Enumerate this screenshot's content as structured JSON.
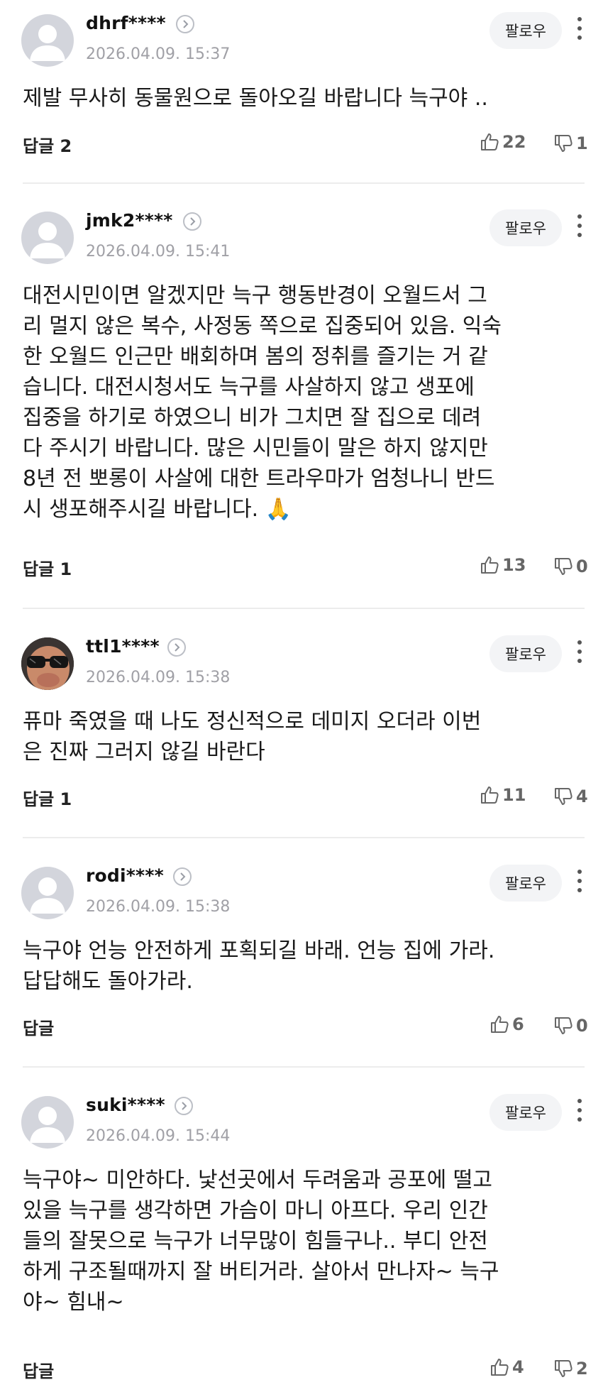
{
  "colors": {
    "text": "#1a1a1a",
    "muted": "#a0a0a6",
    "follow_bg": "#f3f4f6",
    "divider": "#ececec"
  },
  "icons": {
    "profile_chevron": "chevron-right-icon",
    "more": "more-vertical-icon",
    "like": "thumbs-up-icon",
    "dislike": "thumbs-down-icon"
  },
  "comments": [
    {
      "username": "dhrf****",
      "date": "2026.04.09. 15:37",
      "follow_label": "팔로우",
      "text": "제발 무사히 동물원으로 돌아오길 바랍니다 늑구야 ..",
      "reply_label": "답글 2",
      "likes": "22",
      "dislikes": "1"
    },
    {
      "username": "jmk2****",
      "date": "2026.04.09. 15:41",
      "follow_label": "팔로우",
      "text": "대전시민이면 알겠지만 늑구 행동반경이 오월드서 그\n리 멀지 않은 복수, 사정동 쪽으로 집중되어 있음. 익숙\n한 오월드 인근만 배회하며 봄의 정취를 즐기는 거 같\n습니다. 대전시청서도 늑구를 사살하지 않고 생포에\n집중을 하기로 하였으니 비가 그치면 잘 집으로 데려\n다 주시기 바랍니다. 많은 시민들이 말은 하지 않지만\n8년 전 뽀롱이 사살에 대한 트라우마가 엄청나니 반드\n시 생포해주시길 바랍니다. 🙏",
      "reply_label": "답글 1",
      "likes": "13",
      "dislikes": "0"
    },
    {
      "username": "ttl1****",
      "date": "2026.04.09. 15:38",
      "follow_label": "팔로우",
      "text": "퓨마 죽였을 때 나도 정신적으로 데미지 오더라 이번\n은 진짜 그러지 않길 바란다",
      "reply_label": "답글 1",
      "likes": "11",
      "dislikes": "4"
    },
    {
      "username": "rodi****",
      "date": "2026.04.09. 15:38",
      "follow_label": "팔로우",
      "text": "늑구야 언능 안전하게 포획되길 바래. 언능 집에 가라.\n답답해도 돌아가라.",
      "reply_label": "답글",
      "likes": "6",
      "dislikes": "0"
    },
    {
      "username": "suki****",
      "date": "2026.04.09. 15:44",
      "follow_label": "팔로우",
      "text": "늑구야~ 미안하다. 낯선곳에서 두려움과 공포에 떨고\n있을 늑구를 생각하면 가슴이 마니 아프다. 우리 인간\n들의 잘못으로 늑구가 너무많이 힘들구나.. 부디 안전\n하게 구조될때까지 잘 버티거라. 살아서 만나자~ 늑구\n야~ 힘내~",
      "reply_label": "답글",
      "likes": "4",
      "dislikes": "2"
    }
  ]
}
